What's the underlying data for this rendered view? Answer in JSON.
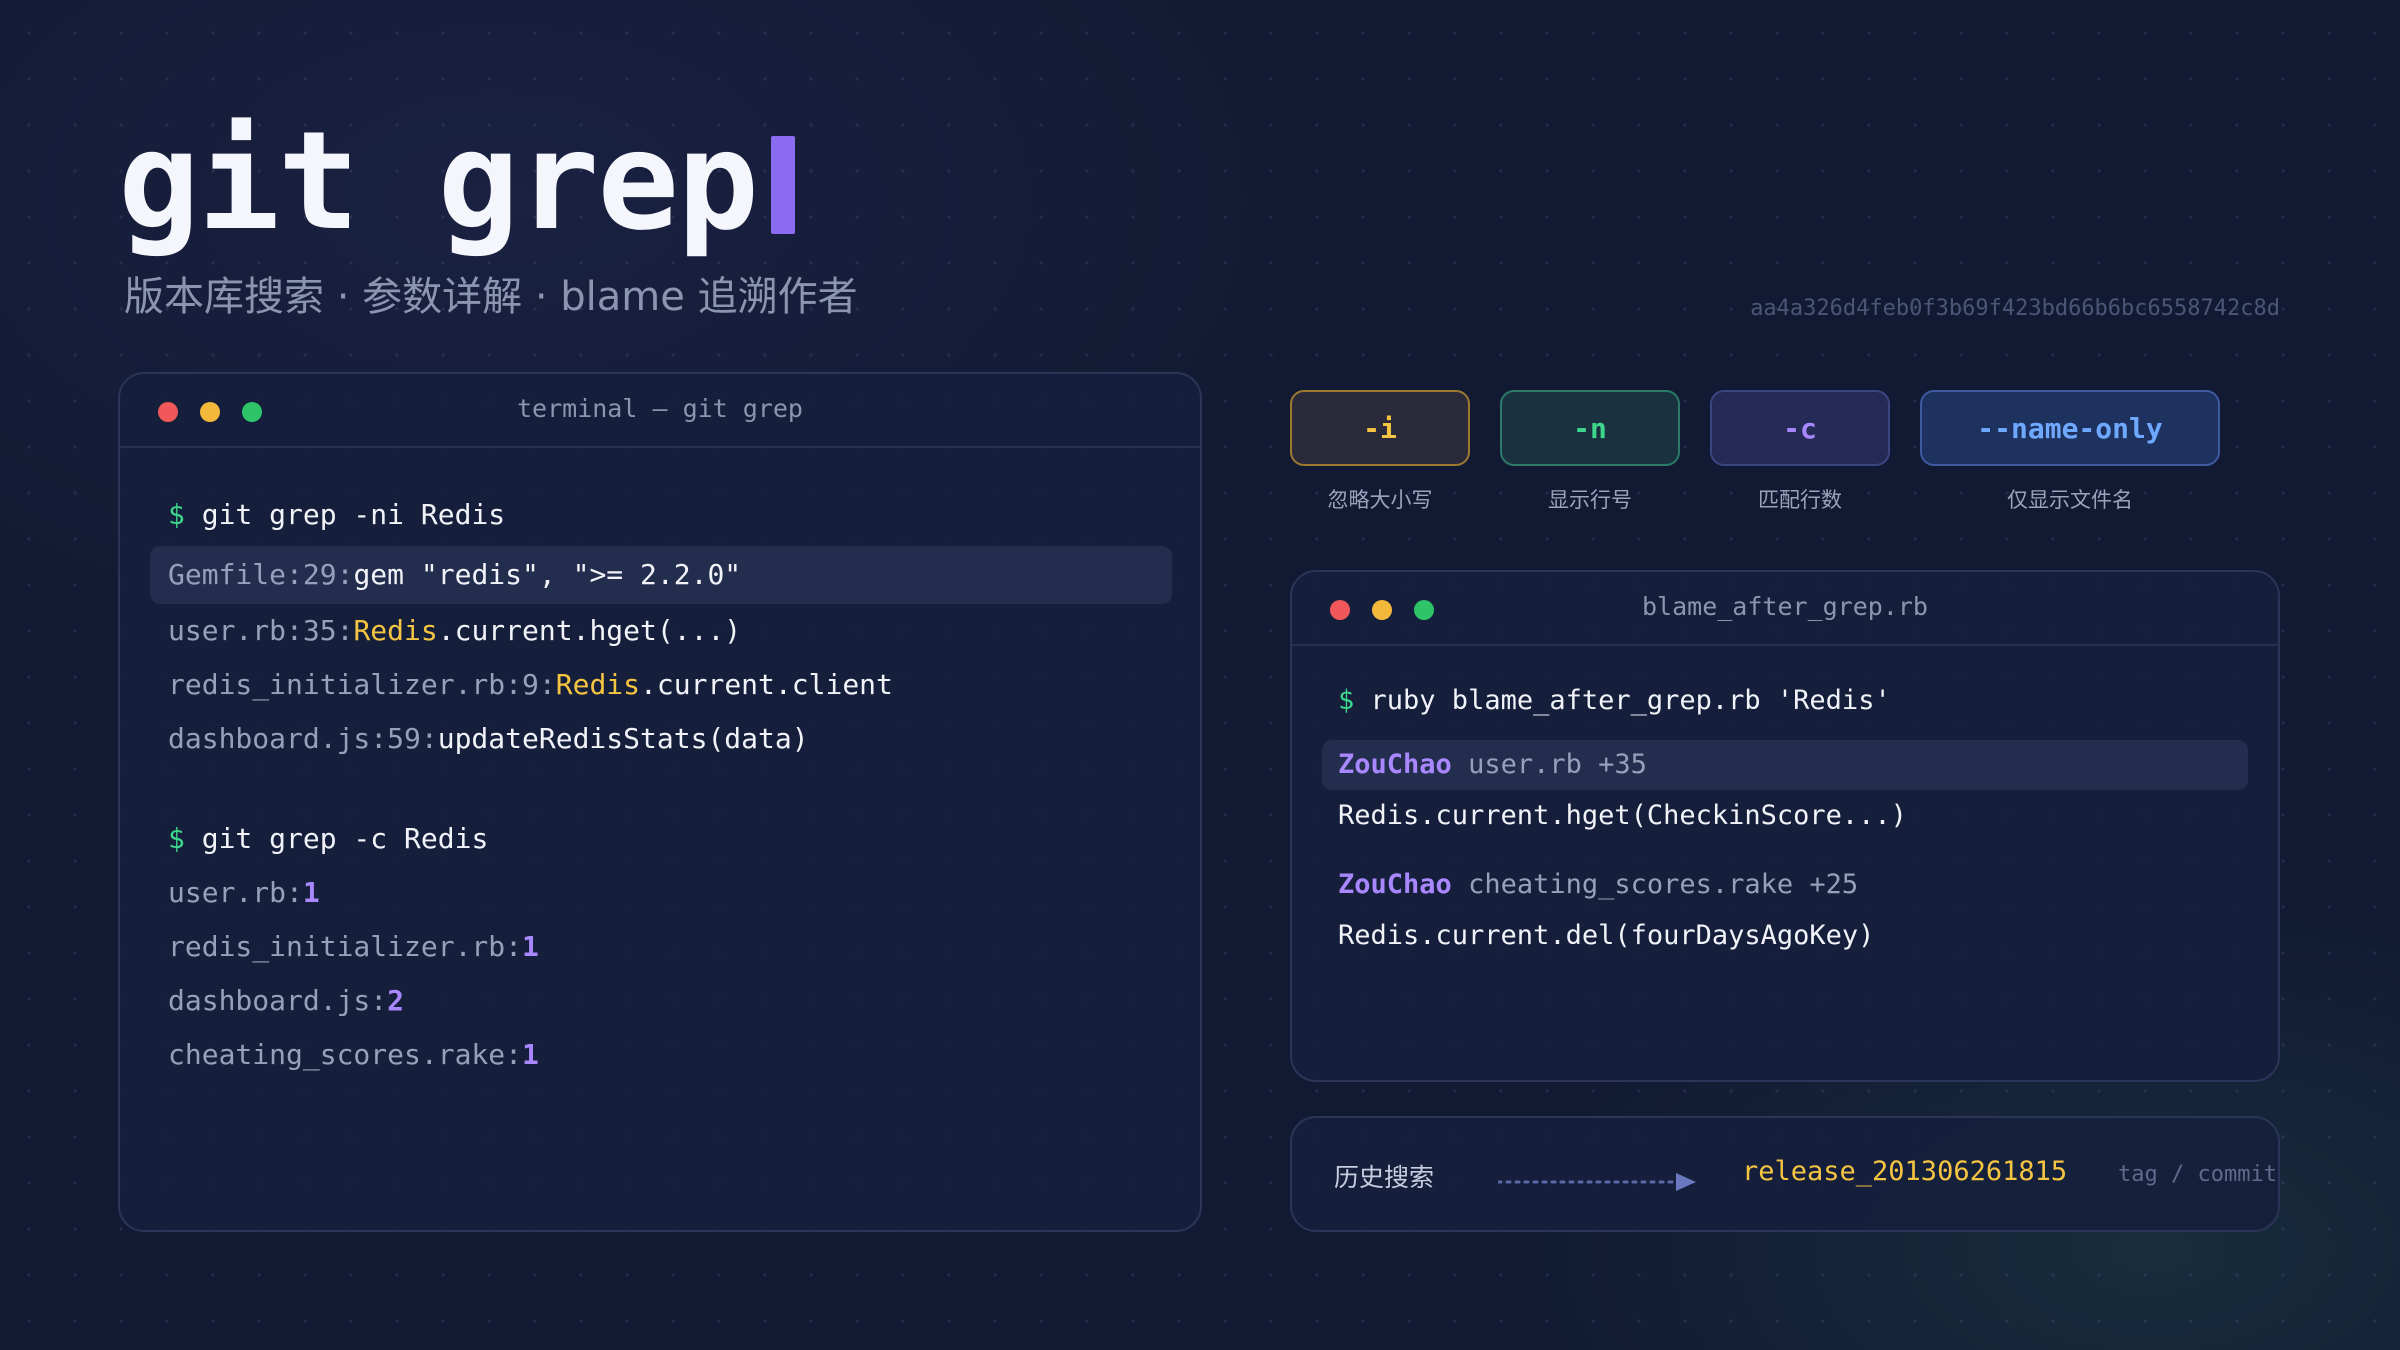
{
  "header": {
    "title": "git grep",
    "subtitle": "版本库搜索 · 参数详解 · blame 追溯作者",
    "hash": "aa4a326d4feb0f3b69f423bd66b6bc6558742c8d"
  },
  "terminal": {
    "title": "terminal — git grep",
    "prompt": "$",
    "cmd1": "git grep -ni Redis",
    "results1": [
      {
        "path": "Gemfile:29:",
        "pre": "gem \"redis\", \">= 2.2.0\"",
        "hl": "",
        "post": ""
      },
      {
        "path": "user.rb:35:",
        "pre": "",
        "hl": "Redis",
        "post": ".current.hget(...)"
      },
      {
        "path": "redis_initializer.rb:9:",
        "pre": "",
        "hl": "Redis",
        "post": ".current.client"
      },
      {
        "path": "dashboard.js:59:",
        "pre": "updateRedisStats(data)",
        "hl": "",
        "post": ""
      }
    ],
    "cmd2": "git grep -c Redis",
    "results2": [
      {
        "path": "user.rb:",
        "count": "1"
      },
      {
        "path": "redis_initializer.rb:",
        "count": "1"
      },
      {
        "path": "dashboard.js:",
        "count": "2"
      },
      {
        "path": "cheating_scores.rake:",
        "count": "1"
      }
    ]
  },
  "flags": [
    {
      "flag": "-i",
      "label": "忽略大小写"
    },
    {
      "flag": "-n",
      "label": "显示行号"
    },
    {
      "flag": "-c",
      "label": "匹配行数"
    },
    {
      "flag": "--name-only",
      "label": "仅显示文件名"
    }
  ],
  "blame": {
    "title": "blame_after_grep.rb",
    "prompt": "$",
    "cmd": "ruby blame_after_grep.rb 'Redis'",
    "entries": [
      {
        "author": "ZouChao",
        "location": "user.rb +35",
        "code": "Redis.current.hget(CheckinScore...)"
      },
      {
        "author": "ZouChao",
        "location": "cheating_scores.rake +25",
        "code": "Redis.current.del(fourDaysAgoKey)"
      }
    ]
  },
  "history": {
    "label": "历史搜索",
    "value": "release_201306261815",
    "tag": "tag / commit"
  },
  "colors": {
    "accent_purple": "#8b6cf0",
    "highlight_yellow": "#f5c542",
    "prompt_green": "#3dd68c",
    "name_only_blue": "#6ea8ff"
  }
}
